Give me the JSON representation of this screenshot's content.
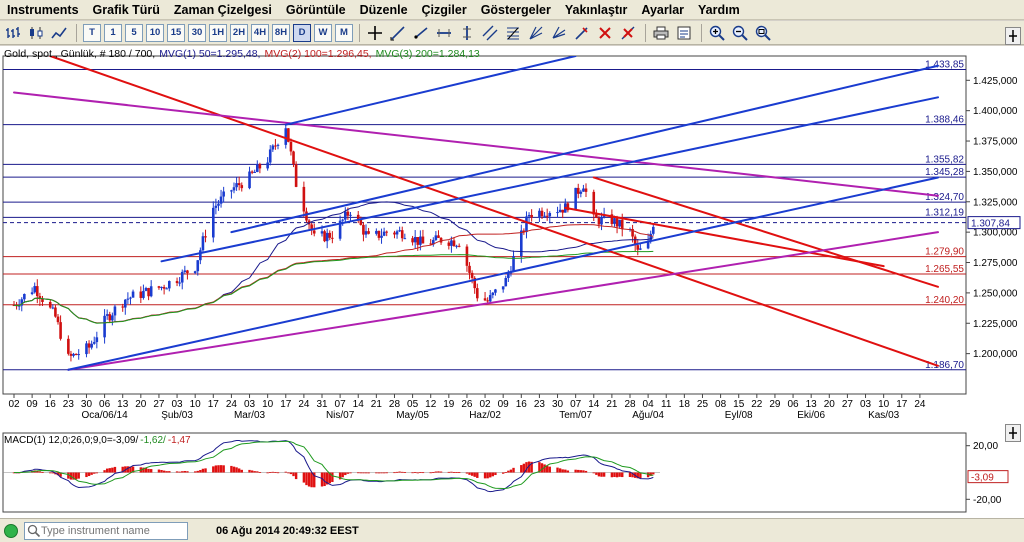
{
  "menu": [
    "Instruments",
    "Grafik Türü",
    "Zaman Çizelgesi",
    "Görüntüle",
    "Düzenle",
    "Çizgiler",
    "Göstergeler",
    "Yakınlaştır",
    "Ayarlar",
    "Yardım"
  ],
  "toolbar": {
    "timeframes": [
      "T",
      "1",
      "5",
      "10",
      "15",
      "30",
      "1H",
      "2H",
      "4H",
      "8H",
      "D",
      "W",
      "M"
    ],
    "selected_timeframe": "D"
  },
  "chart": {
    "info": {
      "instrument": "Gold, spot , Günlük, # 180 / 700,",
      "mvg1": "MVG(1) 50=1.295,48,",
      "mvg2": "MVG(2) 100=1.296,45,",
      "mvg3": "MVG(3) 200=1.284,13"
    },
    "price_axis": [
      "1.425,000",
      "1.400,000",
      "1.375,000",
      "1.350,000",
      "1.325,000",
      "1.300,000",
      "1.275,000",
      "1.250,000",
      "1.225,000",
      "1.200,000"
    ],
    "level_labels": [
      "1.433,85",
      "1.388,46",
      "1.355,82",
      "1.345,28",
      "1.324,70",
      "1.312,19",
      "1.279,90",
      "1.265,55",
      "1.240,20",
      "1.186,70"
    ],
    "current_price": "1.307,84",
    "date_ticks": [
      "02",
      "09",
      "16",
      "23",
      "30",
      "06",
      "13",
      "20",
      "27",
      "03",
      "10",
      "17",
      "24",
      "03",
      "10",
      "17",
      "24",
      "31",
      "07",
      "14",
      "21",
      "28",
      "05",
      "12",
      "19",
      "26",
      "02",
      "09",
      "16",
      "23",
      "30",
      "07",
      "14",
      "21",
      "28",
      "04",
      "11",
      "18",
      "25",
      "08",
      "15",
      "22",
      "29",
      "06",
      "13",
      "20",
      "27",
      "03",
      "10",
      "17",
      "24"
    ],
    "month_labels": [
      "Oca/06/14",
      "Şub/03",
      "Mar/03",
      "Nis/07",
      "May/05",
      "Haz/02",
      "Tem/07",
      "Ağu/04",
      "Eyl/08",
      "Eki/06",
      "Kas/03"
    ]
  },
  "chart_data": {
    "type": "candlestick",
    "instrument": "Gold, spot",
    "timeframe": "Günlük",
    "x_range": [
      "2013-12-02",
      "2014-11-24"
    ],
    "ylim": [
      1175,
      1445
    ],
    "price_path": [
      [
        "2013-12-02",
        1240
      ],
      [
        "2013-12-10",
        1255
      ],
      [
        "2013-12-18",
        1230
      ],
      [
        "2013-12-23",
        1196
      ],
      [
        "2013-12-31",
        1205
      ],
      [
        "2014-01-07",
        1230
      ],
      [
        "2014-01-14",
        1245
      ],
      [
        "2014-01-21",
        1250
      ],
      [
        "2014-01-28",
        1255
      ],
      [
        "2014-02-03",
        1262
      ],
      [
        "2014-02-10",
        1272
      ],
      [
        "2014-02-17",
        1320
      ],
      [
        "2014-02-24",
        1335
      ],
      [
        "2014-03-03",
        1345
      ],
      [
        "2014-03-10",
        1360
      ],
      [
        "2014-03-17",
        1388
      ],
      [
        "2014-03-21",
        1340
      ],
      [
        "2014-03-28",
        1295
      ],
      [
        "2014-04-04",
        1298
      ],
      [
        "2014-04-11",
        1318
      ],
      [
        "2014-04-18",
        1295
      ],
      [
        "2014-04-25",
        1300
      ],
      [
        "2014-05-02",
        1300
      ],
      [
        "2014-05-09",
        1290
      ],
      [
        "2014-05-16",
        1294
      ],
      [
        "2014-05-23",
        1292
      ],
      [
        "2014-05-30",
        1248
      ],
      [
        "2014-06-03",
        1243
      ],
      [
        "2014-06-10",
        1260
      ],
      [
        "2014-06-19",
        1315
      ],
      [
        "2014-06-26",
        1318
      ],
      [
        "2014-07-03",
        1320
      ],
      [
        "2014-07-10",
        1340
      ],
      [
        "2014-07-14",
        1310
      ],
      [
        "2014-07-21",
        1310
      ],
      [
        "2014-07-28",
        1300
      ],
      [
        "2014-07-31",
        1283
      ],
      [
        "2014-08-04",
        1290
      ],
      [
        "2014-08-06",
        1307.84
      ]
    ],
    "moving_averages": [
      {
        "name": "MVG(1) 50",
        "value": 1295.48,
        "color": "#1a1a8c"
      },
      {
        "name": "MVG(2) 100",
        "value": 1296.45,
        "color": "#c02020"
      },
      {
        "name": "MVG(3) 200",
        "value": 1284.13,
        "color": "#1f9a1f"
      }
    ],
    "horizontal_levels": [
      {
        "value": 1433.85,
        "color": "#1a1a8c"
      },
      {
        "value": 1388.46,
        "color": "#1a1a8c"
      },
      {
        "value": 1355.82,
        "color": "#1a1a8c"
      },
      {
        "value": 1345.28,
        "color": "#1a1a8c"
      },
      {
        "value": 1324.7,
        "color": "#1a1a8c"
      },
      {
        "value": 1312.19,
        "color": "#1a1a8c"
      },
      {
        "value": 1279.9,
        "color": "#c02020"
      },
      {
        "value": 1265.55,
        "color": "#c02020"
      },
      {
        "value": 1240.2,
        "color": "#c02020"
      },
      {
        "value": 1186.7,
        "color": "#1a1a8c"
      }
    ],
    "trendlines": [
      {
        "color": "#e01010",
        "from": [
          "2013-12-16",
          1445
        ],
        "to": [
          "2014-11-24",
          1190
        ]
      },
      {
        "color": "#e01010",
        "from": [
          "2014-07-14",
          1345
        ],
        "to": [
          "2014-11-24",
          1255
        ]
      },
      {
        "color": "#e01010",
        "from": [
          "2014-07-03",
          1320
        ],
        "to": [
          "2014-11-03",
          1272
        ]
      },
      {
        "color": "#b020b0",
        "from": [
          "2013-12-02",
          1415
        ],
        "to": [
          "2014-11-24",
          1330
        ]
      },
      {
        "color": "#b020b0",
        "from": [
          "2013-12-23",
          1186.7
        ],
        "to": [
          "2014-11-24",
          1300
        ]
      },
      {
        "color": "#1a3cd0",
        "from": [
          "2013-12-23",
          1186.7
        ],
        "to": [
          "2014-11-24",
          1345
        ]
      },
      {
        "color": "#1a3cd0",
        "from": [
          "2014-01-28",
          1276
        ],
        "to": [
          "2014-11-24",
          1411
        ]
      },
      {
        "color": "#1a3cd0",
        "from": [
          "2014-03-17",
          1388.46
        ],
        "to": [
          "2014-07-07",
          1445
        ]
      },
      {
        "color": "#1a3cd0",
        "from": [
          "2014-02-24",
          1300
        ],
        "to": [
          "2014-11-24",
          1437
        ]
      }
    ],
    "current_price": 1307.84,
    "macd": {
      "label": "MACD(1) 12,0;26,0;9,0=-3,09/-1,62/-1,47",
      "current": -3.09,
      "ticks": [
        20,
        0,
        -20
      ],
      "ylim": [
        -25,
        25
      ]
    }
  },
  "macd_info": {
    "main": "MACD(1) 12,0;26,0;9,0=-3,09/",
    "signal": "-1,62/",
    "hist": "-1,47"
  },
  "macd_axis": [
    "20,00",
    "-20,00"
  ],
  "macd_current": "-3,09",
  "statusbar": {
    "search_placeholder": "Type instrument name",
    "datetime": "06 Ağu 2014 20:49:32 EEST"
  },
  "colors": {
    "level_blue": "#1a1a8c",
    "level_red": "#c02020",
    "bull": "#1a3cd0",
    "bear": "#d01010",
    "trend_red": "#e01010",
    "trend_magenta": "#b020b0",
    "trend_blue": "#1a3cd0"
  }
}
